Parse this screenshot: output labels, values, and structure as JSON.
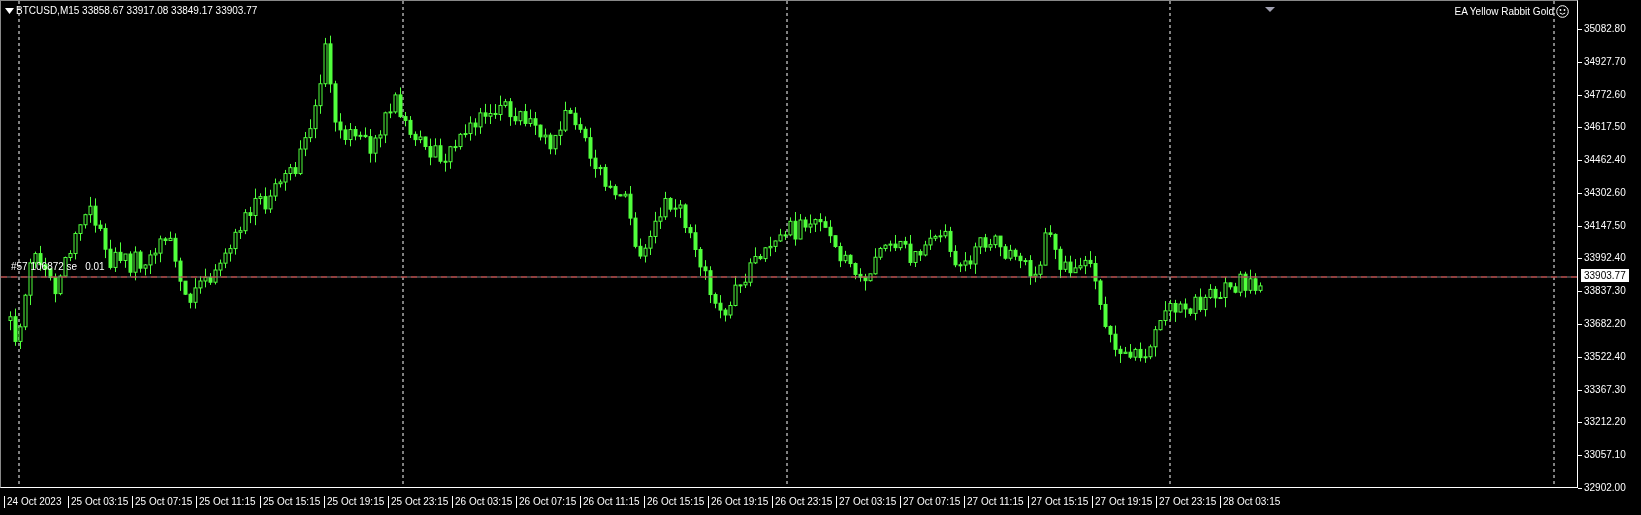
{
  "header": {
    "symbol_info": "BTCUSD,M15  33858.67 33917.08 33849.17 33903.77"
  },
  "expert": {
    "name": "EA Yellow Rabbit Gold"
  },
  "order_line": {
    "label": "#57 106872 se",
    "volume": "0.01"
  },
  "price_axis": {
    "ticks": [
      "35082.80",
      "34927.70",
      "34772.60",
      "34617.50",
      "34462.40",
      "34302.60",
      "34147.50",
      "33992.40",
      "33837.30",
      "33682.20",
      "33522.40",
      "33367.30",
      "33212.20",
      "33057.10",
      "32902.00"
    ],
    "current_price": "33903.77"
  },
  "time_axis": {
    "labels": [
      "24 Oct 2023",
      "25 Oct 03:15",
      "25 Oct 07:15",
      "25 Oct 11:15",
      "25 Oct 15:15",
      "25 Oct 19:15",
      "25 Oct 23:15",
      "26 Oct 03:15",
      "26 Oct 07:15",
      "26 Oct 11:15",
      "26 Oct 15:15",
      "26 Oct 19:15",
      "26 Oct 23:15",
      "27 Oct 03:15",
      "27 Oct 07:15",
      "27 Oct 11:15",
      "27 Oct 15:15",
      "27 Oct 19:15",
      "27 Oct 23:15",
      "28 Oct 03:15"
    ]
  }
}
